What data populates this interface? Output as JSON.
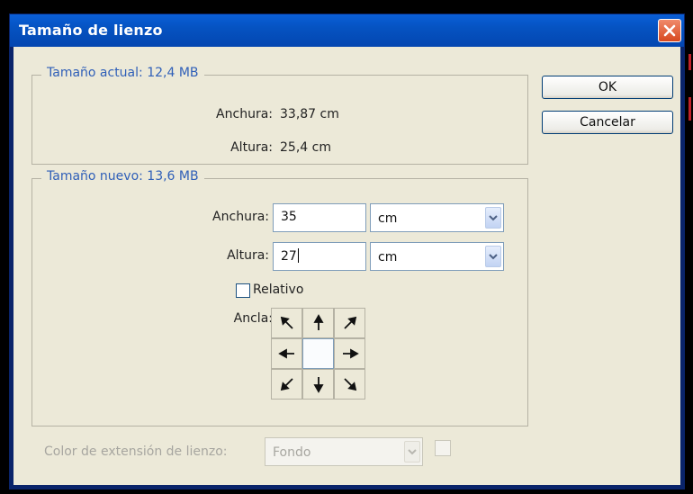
{
  "window": {
    "title": "Tamaño de lienzo"
  },
  "current_size": {
    "legend": "Tamaño actual: 12,4 MB",
    "width_label": "Anchura:",
    "width_value": "33,87 cm",
    "height_label": "Altura:",
    "height_value": "25,4 cm"
  },
  "new_size": {
    "legend": "Tamaño nuevo: 13,6 MB",
    "width_label": "Anchura:",
    "width_value": "35",
    "width_unit": "cm",
    "height_label": "Altura:",
    "height_value": "27",
    "height_unit": "cm",
    "relative_label": "Relativo",
    "relative_checked": false,
    "anchor_label": "Ancla:",
    "anchor_icons": [
      "arrow-up-left-icon",
      "arrow-up-icon",
      "arrow-up-right-icon",
      "arrow-left-icon",
      "",
      "arrow-right-icon",
      "arrow-down-left-icon",
      "arrow-down-icon",
      "arrow-down-right-icon"
    ]
  },
  "extension": {
    "label": "Color de extensión de lienzo:",
    "value": "Fondo"
  },
  "buttons": {
    "ok": "OK",
    "cancel": "Cancelar"
  },
  "colors": {
    "title_bar": "#0553c2",
    "close_button": "#d7491f",
    "dialog_bg": "#ece9d8",
    "legend_text": "#2f5fb8",
    "disabled_text": "#a7a6a0"
  }
}
